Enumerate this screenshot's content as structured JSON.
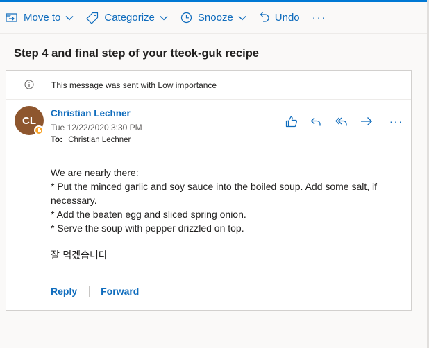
{
  "toolbar": {
    "move_to": "Move to",
    "categorize": "Categorize",
    "snooze": "Snooze",
    "undo": "Undo",
    "more": "···"
  },
  "message": {
    "subject": "Step 4 and final step of your tteok-guk recipe",
    "importance_notice": "This message was sent with Low importance",
    "sender": {
      "initials": "CL",
      "name": "Christian Lechner",
      "avatar_color": "#8e562e",
      "presence_color": "#f8a42b",
      "presence": "away-icon"
    },
    "date": "Tue 12/22/2020 3:30 PM",
    "to_label": "To:",
    "to": "Christian Lechner",
    "actions": {
      "icons": [
        "like-icon",
        "reply-icon",
        "reply-all-icon",
        "forward-icon",
        "more-icon"
      ],
      "more": "···"
    },
    "body": {
      "line1": "We are nearly there:",
      "line2": "* Put the minced garlic and soy sauce into the boiled soup. Add some salt, if necessary.",
      "line3": "* Add the beaten egg and sliced spring onion.",
      "line4": "* Serve the soup with pepper drizzled on top.",
      "closing": "잘 먹겠습니다"
    },
    "reply_label": "Reply",
    "forward_label": "Forward"
  },
  "colors": {
    "accent": "#0f6cbd",
    "top_bar": "#0078d4"
  }
}
